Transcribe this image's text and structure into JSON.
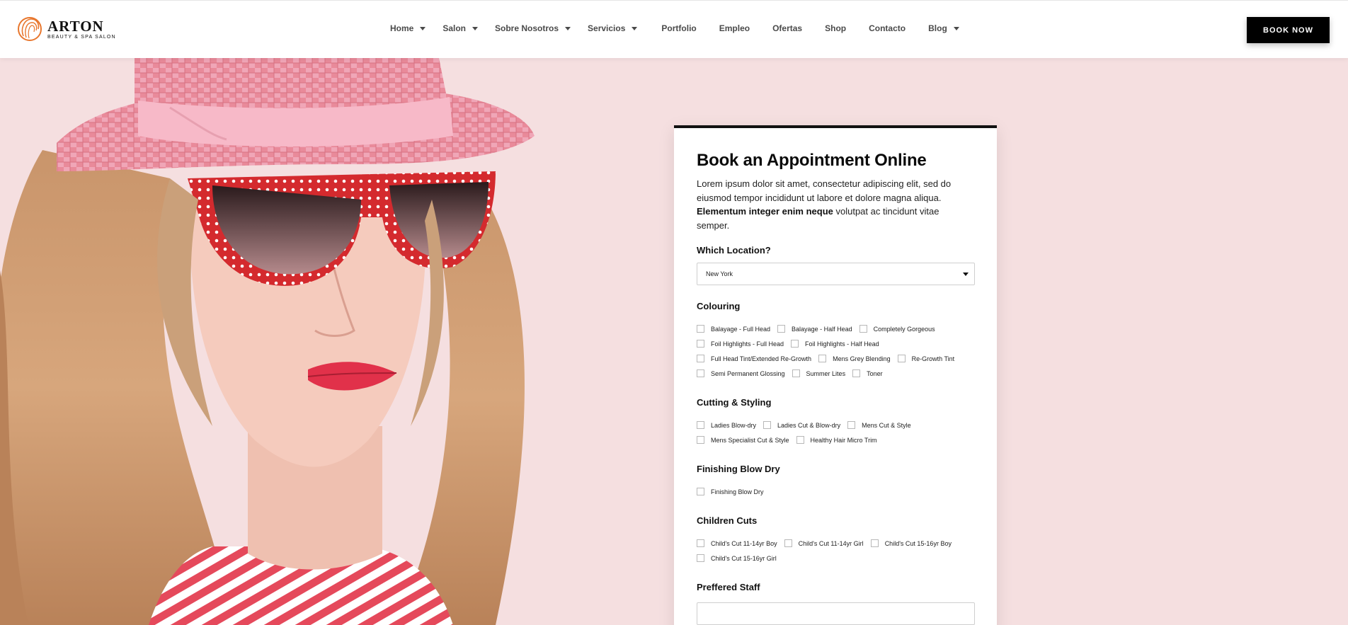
{
  "header": {
    "logo": {
      "name": "ARTON",
      "tagline": "BEAUTY & SPA SALON"
    },
    "nav": [
      {
        "label": "Home",
        "has_dropdown": true
      },
      {
        "label": "Salon",
        "has_dropdown": true
      },
      {
        "label": "Sobre Nosotros",
        "has_dropdown": true
      },
      {
        "label": "Servicios",
        "has_dropdown": true
      },
      {
        "label": "Portfolio",
        "has_dropdown": false
      },
      {
        "label": "Empleo",
        "has_dropdown": false
      },
      {
        "label": "Ofertas",
        "has_dropdown": false
      },
      {
        "label": "Shop",
        "has_dropdown": false
      },
      {
        "label": "Contacto",
        "has_dropdown": false
      },
      {
        "label": "Blog",
        "has_dropdown": true
      }
    ],
    "cta_label": "BOOK NOW"
  },
  "booking": {
    "title": "Book an Appointment Online",
    "desc_text": "Lorem ipsum dolor sit amet, consectetur adipiscing elit, sed do eiusmod tempor incididunt ut labore et dolore magna aliqua. ",
    "desc_bold": "Elementum integer enim neque",
    "desc_tail": " volutpat ac tincidunt vitae semper.",
    "location": {
      "label": "Which Location?",
      "value": "New York"
    },
    "groups": [
      {
        "label": "Colouring",
        "rows": [
          [
            "Balayage - Full Head",
            "Balayage - Half Head",
            "Completely Gorgeous"
          ],
          [
            "Foil Highlights - Full Head",
            "Foil Highlights - Half Head"
          ],
          [
            "Full Head Tint/Extended Re-Growth",
            "Mens Grey Blending",
            "Re-Growth Tint"
          ],
          [
            "Semi Permanent Glossing",
            "Summer Lites",
            "Toner"
          ]
        ]
      },
      {
        "label": "Cutting & Styling",
        "rows": [
          [
            "Ladies Blow-dry",
            "Ladies Cut & Blow-dry",
            "Mens Cut & Style"
          ],
          [
            "Mens Specialist Cut & Style",
            "Healthy Hair Micro Trim"
          ]
        ]
      },
      {
        "label": "Finishing Blow Dry",
        "rows": [
          [
            "Finishing Blow Dry"
          ]
        ]
      },
      {
        "label": "Children Cuts",
        "rows": [
          [
            "Child's Cut 11-14yr Boy",
            "Child's Cut 11-14yr Girl",
            "Child's Cut 15-16yr Boy"
          ],
          [
            "Child's Cut 15-16yr Girl"
          ]
        ]
      }
    ],
    "staff_label": "Preffered Staff"
  },
  "colors": {
    "page_bg": "#f5dfe0",
    "accent": "#000000",
    "logo_orange": "#e8772e"
  },
  "icons": {
    "logo": "woman-face-logo-icon",
    "dropdown": "caret-down-icon",
    "select": "caret-down-icon"
  }
}
